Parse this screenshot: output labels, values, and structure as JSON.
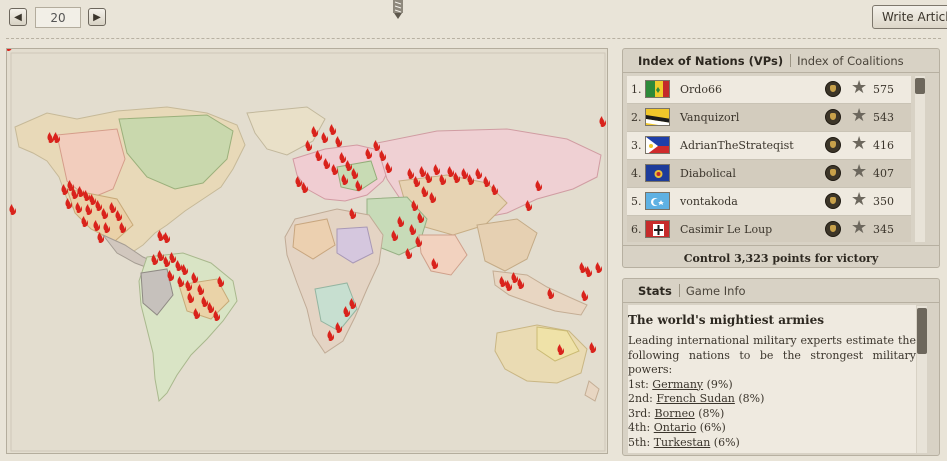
{
  "toolbar": {
    "day_value": "20",
    "write_article_label": "Write Article"
  },
  "nations_panel": {
    "tab_active": "Index of Nations (VPs)",
    "tab_inactive": "Index of Coalitions",
    "rows": [
      {
        "rank": "1.",
        "name": "Ordo66",
        "vp": "575",
        "flag": "green-gold-red"
      },
      {
        "rank": "2.",
        "name": "Vanquizorl",
        "vp": "543",
        "flag": "gold-black-white"
      },
      {
        "rank": "3.",
        "name": "AdrianTheStrateqist",
        "vp": "416",
        "flag": "philippines"
      },
      {
        "rank": "4.",
        "name": "Diabolical",
        "vp": "407",
        "flag": "blue-emblem"
      },
      {
        "rank": "5.",
        "name": "vontakoda",
        "vp": "350",
        "flag": "lightblue-crescent"
      },
      {
        "rank": "6.",
        "name": "Casimir Le Loup",
        "vp": "345",
        "flag": "red-black-cross"
      }
    ],
    "victory_text": "Control 3,323 points for victory"
  },
  "stats_panel": {
    "tab_active": "Stats",
    "tab_inactive": "Game Info",
    "title": "The world's mightiest armies",
    "intro": "Leading international military experts estimate the following nations to be the strongest military powers:",
    "rankings": [
      {
        "place": "1st:",
        "country": "Germany",
        "share": "(9%)"
      },
      {
        "place": "2nd:",
        "country": "French Sudan",
        "share": "(8%)"
      },
      {
        "place": "3rd:",
        "country": "Borneo",
        "share": "(8%)"
      },
      {
        "place": "4th:",
        "country": "Ontario",
        "share": "(6%)"
      },
      {
        "place": "5th:",
        "country": "Turkestan",
        "share": "(6%)"
      }
    ]
  },
  "colors": {
    "background": "#e9e4d8",
    "panel": "#d8d2c5",
    "fire_marker": "#d9231c"
  },
  "icons": [
    "arrow-left-icon",
    "arrow-right-icon",
    "flag-pin-icon",
    "medal-icon",
    "star-icon",
    "fire-marker-icon"
  ]
}
